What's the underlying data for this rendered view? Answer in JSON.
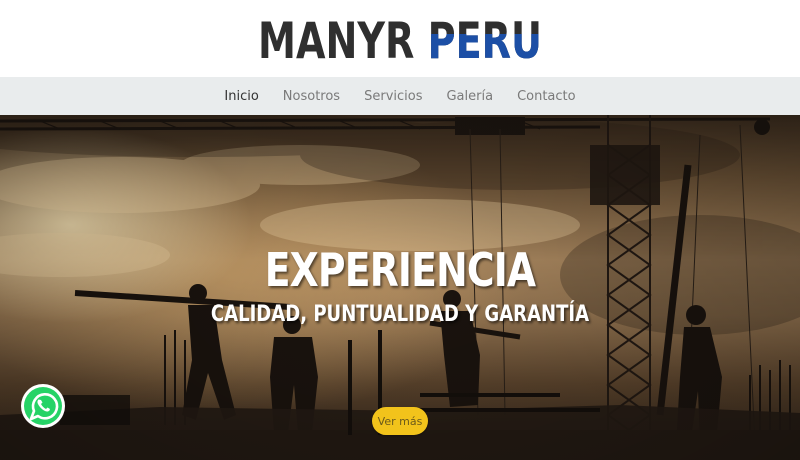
{
  "brand": {
    "logo_text": "MANYR PERU",
    "colors": {
      "dark": "#2f2f2f",
      "blue": "#1c4fa6"
    }
  },
  "nav": {
    "items": [
      {
        "label": "Inicio",
        "active": true
      },
      {
        "label": "Nosotros",
        "active": false
      },
      {
        "label": "Servicios",
        "active": false
      },
      {
        "label": "Galería",
        "active": false
      },
      {
        "label": "Contacto",
        "active": false
      }
    ]
  },
  "hero": {
    "title": "EXPERIENCIA",
    "subtitle": "CALIDAD, PUNTUALIDAD Y GARANTÍA",
    "button_label": "Ver más",
    "button_color": "#f2c31b"
  },
  "floating": {
    "whatsapp_icon": "whatsapp-icon",
    "whatsapp_color": "#25d366"
  }
}
